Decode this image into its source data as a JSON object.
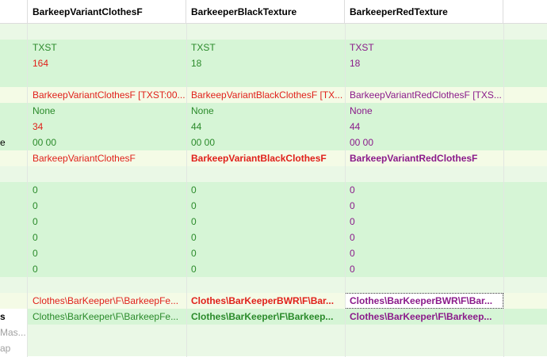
{
  "columns": [
    {
      "header": "BarkeepVariantClothesF"
    },
    {
      "header": "BarkeeperBlackTexture"
    },
    {
      "header": "BarkeeperRedTexture"
    }
  ],
  "colors": {
    "green_text": "#2a8a2a",
    "red_text": "#e0201a",
    "purple_text": "#8a1a8a",
    "black_text": "#333333",
    "grey_text": "#a0a0a0"
  },
  "rows": [
    {
      "bg": "#eaf8e6",
      "label": "",
      "cells": [
        {
          "text": ""
        },
        {
          "text": ""
        },
        {
          "text": ""
        }
      ]
    },
    {
      "bg": "#d6f5d6",
      "label": "",
      "cells": [
        {
          "text": "TXST",
          "color": "#2a8a2a"
        },
        {
          "text": "TXST",
          "color": "#2a8a2a"
        },
        {
          "text": "TXST",
          "color": "#8a1a8a"
        }
      ]
    },
    {
      "bg": "#d6f5d6",
      "label": "",
      "cells": [
        {
          "text": "164",
          "color": "#e0201a"
        },
        {
          "text": "18",
          "color": "#2a8a2a"
        },
        {
          "text": "18",
          "color": "#8a1a8a"
        }
      ]
    },
    {
      "bg": "#d6f5d6",
      "label": "",
      "cells": [
        {
          "text": ""
        },
        {
          "text": ""
        },
        {
          "text": ""
        }
      ]
    },
    {
      "bg": "#f4fbe6",
      "label": "",
      "cells": [
        {
          "text": "BarkeepVariantClothesF [TXST:00...",
          "color": "#e0201a"
        },
        {
          "text": "BarkeepVariantBlackClothesF [TX...",
          "color": "#e0201a"
        },
        {
          "text": "BarkeepVariantRedClothesF [TXS...",
          "color": "#8a1a8a"
        }
      ]
    },
    {
      "bg": "#d6f5d6",
      "label": "",
      "cells": [
        {
          "text": "None",
          "color": "#2a8a2a"
        },
        {
          "text": "None",
          "color": "#2a8a2a"
        },
        {
          "text": "None",
          "color": "#8a1a8a"
        }
      ]
    },
    {
      "bg": "#d6f5d6",
      "label": "",
      "cells": [
        {
          "text": "34",
          "color": "#e0201a"
        },
        {
          "text": "44",
          "color": "#2a8a2a"
        },
        {
          "text": "44",
          "color": "#8a1a8a"
        }
      ]
    },
    {
      "bg": "#d6f5d6",
      "label": "e",
      "cells": [
        {
          "text": "00 00",
          "color": "#2a8a2a"
        },
        {
          "text": "00 00",
          "color": "#2a8a2a"
        },
        {
          "text": "00 00",
          "color": "#8a1a8a"
        }
      ]
    },
    {
      "bg": "#f4fbe6",
      "label": "",
      "cells": [
        {
          "text": "BarkeepVariantClothesF",
          "color": "#e0201a"
        },
        {
          "text": "BarkeepVariantBlackClothesF",
          "color": "#e0201a",
          "bold": true
        },
        {
          "text": "BarkeepVariantRedClothesF",
          "color": "#8a1a8a",
          "bold": true
        }
      ]
    },
    {
      "bg": "#eaf8e6",
      "label": "",
      "cells": [
        {
          "text": ""
        },
        {
          "text": ""
        },
        {
          "text": ""
        }
      ]
    },
    {
      "bg": "#d6f5d6",
      "label": "",
      "cells": [
        {
          "text": "0",
          "color": "#2a8a2a"
        },
        {
          "text": "0",
          "color": "#2a8a2a"
        },
        {
          "text": "0",
          "color": "#8a1a8a"
        }
      ]
    },
    {
      "bg": "#d6f5d6",
      "label": "",
      "cells": [
        {
          "text": "0",
          "color": "#2a8a2a"
        },
        {
          "text": "0",
          "color": "#2a8a2a"
        },
        {
          "text": "0",
          "color": "#8a1a8a"
        }
      ]
    },
    {
      "bg": "#d6f5d6",
      "label": "",
      "cells": [
        {
          "text": "0",
          "color": "#2a8a2a"
        },
        {
          "text": "0",
          "color": "#2a8a2a"
        },
        {
          "text": "0",
          "color": "#8a1a8a"
        }
      ]
    },
    {
      "bg": "#d6f5d6",
      "label": "",
      "cells": [
        {
          "text": "0",
          "color": "#2a8a2a"
        },
        {
          "text": "0",
          "color": "#2a8a2a"
        },
        {
          "text": "0",
          "color": "#8a1a8a"
        }
      ]
    },
    {
      "bg": "#d6f5d6",
      "label": "",
      "cells": [
        {
          "text": "0",
          "color": "#2a8a2a"
        },
        {
          "text": "0",
          "color": "#2a8a2a"
        },
        {
          "text": "0",
          "color": "#8a1a8a"
        }
      ]
    },
    {
      "bg": "#d6f5d6",
      "label": "",
      "cells": [
        {
          "text": "0",
          "color": "#2a8a2a"
        },
        {
          "text": "0",
          "color": "#2a8a2a"
        },
        {
          "text": "0",
          "color": "#8a1a8a"
        }
      ]
    },
    {
      "bg": "#eaf8e6",
      "label": "",
      "cells": [
        {
          "text": ""
        },
        {
          "text": ""
        },
        {
          "text": ""
        }
      ]
    },
    {
      "bg": "#f4fbe6",
      "label": "",
      "cells": [
        {
          "text": "Clothes\\BarKeeper\\F\\BarkeepFe...",
          "color": "#e0201a"
        },
        {
          "text": "Clothes\\BarKeeperBWR\\F\\Bar...",
          "color": "#e0201a",
          "bold": true
        },
        {
          "text": "Clothes\\BarKeeperBWR\\F\\Bar...",
          "color": "#8a1a8a",
          "bold": true,
          "focused": true
        }
      ]
    },
    {
      "bg": "#d6f5d6",
      "label": "s",
      "label_bold": true,
      "label_bg": "#ffffff",
      "cells": [
        {
          "text": "Clothes\\BarKeeper\\F\\BarkeepFe...",
          "color": "#2a8a2a"
        },
        {
          "text": "Clothes\\BarKeeper\\F\\Barkeep...",
          "color": "#2a8a2a",
          "bold": true
        },
        {
          "text": "Clothes\\BarKeeper\\F\\Barkeep...",
          "color": "#8a1a8a",
          "bold": true
        }
      ]
    },
    {
      "bg": "#eaf8e6",
      "label": "Mas...",
      "label_color": "#a0a0a0",
      "label_bg": "#ffffff",
      "cells": [
        {
          "text": ""
        },
        {
          "text": ""
        },
        {
          "text": ""
        }
      ]
    },
    {
      "bg": "#eaf8e6",
      "label": "ap",
      "label_color": "#a0a0a0",
      "label_bg": "#ffffff",
      "cells": [
        {
          "text": ""
        },
        {
          "text": ""
        },
        {
          "text": ""
        }
      ]
    }
  ]
}
